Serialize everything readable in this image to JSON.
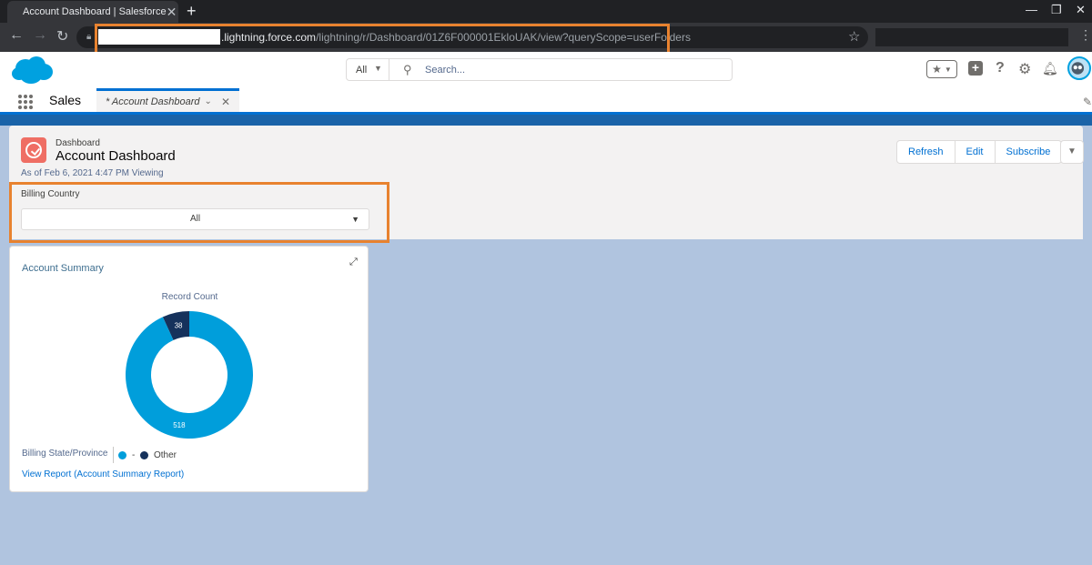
{
  "browser": {
    "tab_title": "Account Dashboard | Salesforce",
    "new_tab": "+",
    "tab_close": "✕",
    "url_host": ".lightning.force.com",
    "url_path": "/lightning/r/Dashboard/01Z6F000001EkloUAK/view?queryScope=userFolders"
  },
  "header": {
    "search_scope": "All",
    "search_placeholder": "Search..."
  },
  "appnav": {
    "app_name": "Sales",
    "tab_label": "* Account Dashboard"
  },
  "dashboard": {
    "type_label": "Dashboard",
    "title": "Account Dashboard",
    "as_of": "As of Feb 6, 2021 4:47 PM Viewing",
    "buttons": {
      "refresh": "Refresh",
      "edit": "Edit",
      "subscribe": "Subscribe"
    },
    "filter": {
      "label": "Billing Country",
      "value": "All"
    }
  },
  "widget": {
    "title": "Account Summary",
    "legend_title": "Billing State/Province",
    "link": "View Report (Account Summary Report)"
  },
  "colors": {
    "accent": "#0070d2",
    "highlight": "#e8822f",
    "series_dash": "#009edb",
    "series_other": "#16325c"
  },
  "chart_data": {
    "type": "pie",
    "variant": "donut",
    "title": "Record Count",
    "categories": [
      "-",
      "Other"
    ],
    "values": [
      518,
      38
    ],
    "colors": [
      "#009edb",
      "#16325c"
    ],
    "legend_placement": "bottom-left"
  }
}
